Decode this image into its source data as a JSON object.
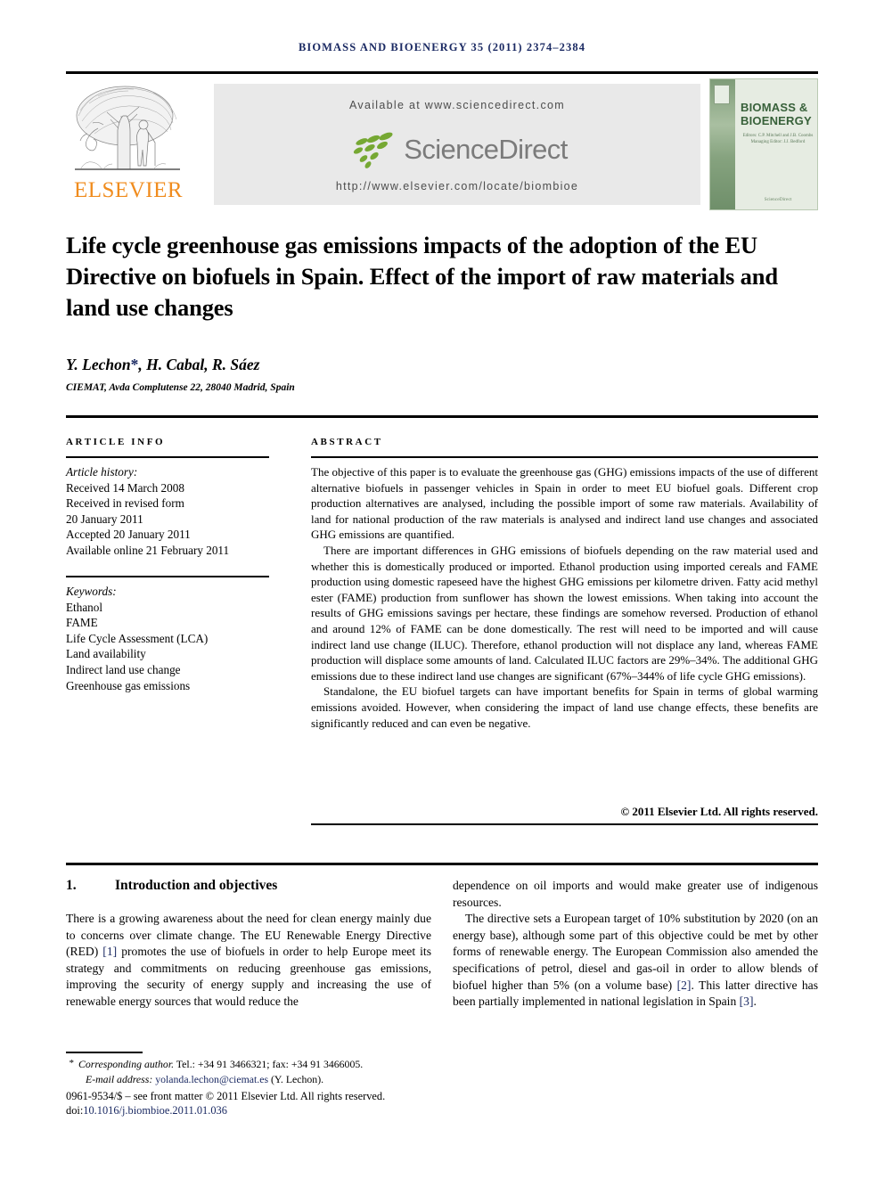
{
  "running_head": {
    "journal": "BIOMASS AND BIOENERGY",
    "volume_line": "35 (2011) 2374–2384",
    "color": "#1b2a63"
  },
  "masthead": {
    "publisher_logo_text": "ELSEVIER",
    "publisher_logo_color": "#f08c1e",
    "available_at": "Available at www.sciencedirect.com",
    "sciencedirect_wordmark": "ScienceDirect",
    "sciencedirect_color": "#7b7b7b",
    "leaf_color": "#76a833",
    "journal_url": "http://www.elsevier.com/locate/biombioe",
    "band_color": "#e9e9e9",
    "cover": {
      "title_line_1": "BIOMASS &",
      "title_line_2": "BIOENERGY",
      "editors_line_1": "Editors: C.P. Mitchell and J.B. Coombs",
      "editors_line_2": "Managing Editor: J.J. Bedford",
      "footer": "ScienceDirect",
      "title_color": "#38613a",
      "background": "#e6ece2"
    }
  },
  "article": {
    "title": "Life cycle greenhouse gas emissions impacts of the adoption of the EU Directive on biofuels in Spain. Effect of the import of raw materials and land use changes",
    "authors": "Y. Lechon",
    "authors_rest": ", H. Cabal, R. Sáez",
    "corresponding_marker": "*",
    "affiliation": "CIEMAT, Avda Complutense 22, 28040 Madrid, Spain"
  },
  "article_info": {
    "heading": "ARTICLE INFO",
    "history_label": "Article history:",
    "history": [
      "Received 14 March 2008",
      "Received in revised form",
      "20 January 2011",
      "Accepted 20 January 2011",
      "Available online 21 February 2011"
    ],
    "keywords_label": "Keywords:",
    "keywords": [
      "Ethanol",
      "FAME",
      "Life Cycle Assessment (LCA)",
      "Land availability",
      "Indirect land use change",
      "Greenhouse gas emissions"
    ]
  },
  "abstract": {
    "heading": "ABSTRACT",
    "paragraphs": [
      "The objective of this paper is to evaluate the greenhouse gas (GHG) emissions impacts of the use of different alternative biofuels in passenger vehicles in Spain in order to meet EU biofuel goals. Different crop production alternatives are analysed, including the possible import of some raw materials. Availability of land for national production of the raw materials is analysed and indirect land use changes and associated GHG emissions are quantified.",
      "There are important differences in GHG emissions of biofuels depending on the raw material used and whether this is domestically produced or imported. Ethanol production using imported cereals and FAME production using domestic rapeseed have the highest GHG emissions per kilometre driven. Fatty acid methyl ester (FAME) production from sunflower has shown the lowest emissions. When taking into account the results of GHG emissions savings per hectare, these findings are somehow reversed. Production of ethanol and around 12% of FAME can be done domestically. The rest will need to be imported and will cause indirect land use change (ILUC). Therefore, ethanol production will not displace any land, whereas FAME production will displace some amounts of land. Calculated ILUC factors are 29%–34%. The additional GHG emissions due to these indirect land use changes are significant (67%–344% of life cycle GHG emissions).",
      "Standalone, the EU biofuel targets can have important benefits for Spain in terms of global warming emissions avoided. However, when considering the impact of land use change effects, these benefits are significantly reduced and can even be negative."
    ],
    "copyright": "© 2011 Elsevier Ltd. All rights reserved."
  },
  "body": {
    "section_number": "1.",
    "section_title": "Introduction and objectives",
    "left_column": {
      "paragraph_1_a": "There is a growing awareness about the need for clean energy mainly due to concerns over climate change. The EU Renewable Energy Directive (RED) ",
      "ref_1": "[1]",
      "paragraph_1_b": " promotes the use of biofuels in order to help Europe meet its strategy and commitments on reducing greenhouse gas emissions, improving the security of energy supply and increasing the use of renewable energy sources that would reduce the"
    },
    "right_column": {
      "continuation": "dependence on oil imports and would make greater use of indigenous resources.",
      "paragraph_2_a": "The directive sets a European target of 10% substitution by 2020 (on an energy base), although some part of this objective could be met by other forms of renewable energy. The European Commission also amended the specifications of petrol, diesel and gas-oil in order to allow blends of biofuel higher than 5% (on a volume base) ",
      "ref_2": "[2]",
      "paragraph_2_b": ". This latter directive has been partially implemented in national legislation in Spain ",
      "ref_3": "[3]",
      "paragraph_2_c": "."
    }
  },
  "footer": {
    "corresponding_star": "*",
    "corresponding_label": "Corresponding author.",
    "corresponding_contact": " Tel.: +34 91 3466321; fax: +34 91 3466005.",
    "email_label": "E-mail address:",
    "email": "yolanda.lechon@ciemat.es",
    "email_owner": " (Y. Lechon).",
    "issn": "0961-9534/$ – see front matter © 2011 Elsevier Ltd. All rights reserved.",
    "doi_label": "doi:",
    "doi_value": "10.1016/j.biombioe.2011.01.036",
    "link_color": "#1b2a63"
  }
}
